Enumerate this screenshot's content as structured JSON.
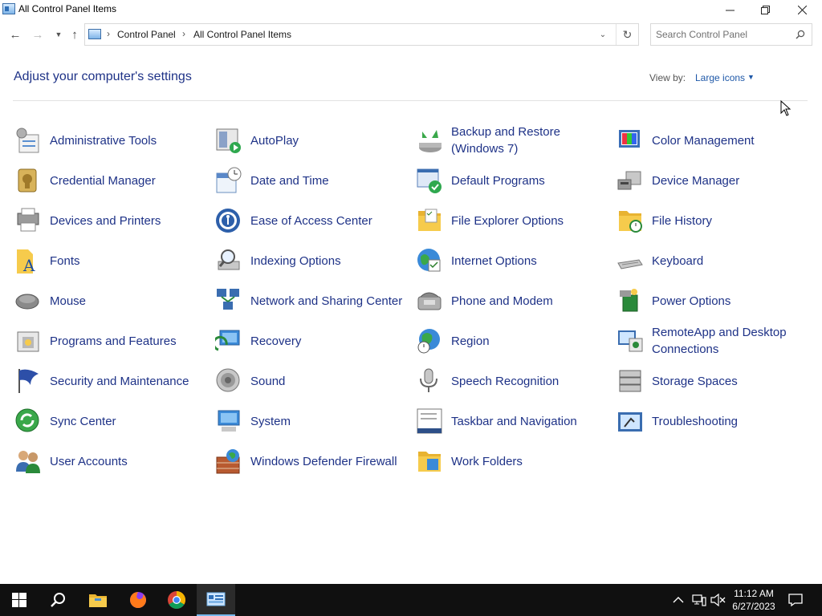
{
  "window": {
    "title": "All Control Panel Items",
    "controls": {
      "minimize": "minimize-icon",
      "maximize": "restore-icon",
      "close": "close-icon"
    }
  },
  "address": {
    "crumbs": [
      "Control Panel",
      "All Control Panel Items"
    ],
    "search_placeholder": "Search Control Panel"
  },
  "header": {
    "heading": "Adjust your computer's settings",
    "view_by_label": "View by:",
    "view_by_value": "Large icons"
  },
  "items": [
    {
      "label": "Administrative Tools",
      "icon": "administrative-tools-icon"
    },
    {
      "label": "AutoPlay",
      "icon": "autoplay-icon"
    },
    {
      "label": "Backup and Restore (Windows 7)",
      "icon": "backup-restore-icon"
    },
    {
      "label": "Color Management",
      "icon": "color-management-icon"
    },
    {
      "label": "Credential Manager",
      "icon": "credential-manager-icon"
    },
    {
      "label": "Date and Time",
      "icon": "date-time-icon"
    },
    {
      "label": "Default Programs",
      "icon": "default-programs-icon"
    },
    {
      "label": "Device Manager",
      "icon": "device-manager-icon"
    },
    {
      "label": "Devices and Printers",
      "icon": "devices-printers-icon"
    },
    {
      "label": "Ease of Access Center",
      "icon": "ease-of-access-icon"
    },
    {
      "label": "File Explorer Options",
      "icon": "file-explorer-options-icon"
    },
    {
      "label": "File History",
      "icon": "file-history-icon"
    },
    {
      "label": "Fonts",
      "icon": "fonts-icon"
    },
    {
      "label": "Indexing Options",
      "icon": "indexing-options-icon"
    },
    {
      "label": "Internet Options",
      "icon": "internet-options-icon"
    },
    {
      "label": "Keyboard",
      "icon": "keyboard-icon"
    },
    {
      "label": "Mouse",
      "icon": "mouse-icon"
    },
    {
      "label": "Network and Sharing Center",
      "icon": "network-sharing-icon"
    },
    {
      "label": "Phone and Modem",
      "icon": "phone-modem-icon"
    },
    {
      "label": "Power Options",
      "icon": "power-options-icon"
    },
    {
      "label": "Programs and Features",
      "icon": "programs-features-icon"
    },
    {
      "label": "Recovery",
      "icon": "recovery-icon"
    },
    {
      "label": "Region",
      "icon": "region-icon"
    },
    {
      "label": "RemoteApp and Desktop Connections",
      "icon": "remoteapp-icon"
    },
    {
      "label": "Security and Maintenance",
      "icon": "security-maintenance-icon"
    },
    {
      "label": "Sound",
      "icon": "sound-icon"
    },
    {
      "label": "Speech Recognition",
      "icon": "speech-recognition-icon"
    },
    {
      "label": "Storage Spaces",
      "icon": "storage-spaces-icon"
    },
    {
      "label": "Sync Center",
      "icon": "sync-center-icon"
    },
    {
      "label": "System",
      "icon": "system-icon"
    },
    {
      "label": "Taskbar and Navigation",
      "icon": "taskbar-navigation-icon"
    },
    {
      "label": "Troubleshooting",
      "icon": "troubleshooting-icon"
    },
    {
      "label": "User Accounts",
      "icon": "user-accounts-icon"
    },
    {
      "label": "Windows Defender Firewall",
      "icon": "firewall-icon"
    },
    {
      "label": "Work Folders",
      "icon": "work-folders-icon"
    }
  ],
  "taskbar": {
    "apps": [
      "start-icon",
      "search-icon",
      "file-explorer-icon",
      "firefox-icon",
      "chrome-icon",
      "control-panel-icon"
    ],
    "active_app": "control-panel-icon",
    "tray_icons": [
      "chevron-up-icon",
      "network-icon",
      "volume-muted-icon"
    ],
    "time": "11:12 AM",
    "date": "6/27/2023",
    "notification_icon": "action-center-icon"
  },
  "colors": {
    "link": "#1e3287",
    "accent": "#76b9ed",
    "taskbar": "#101010"
  }
}
